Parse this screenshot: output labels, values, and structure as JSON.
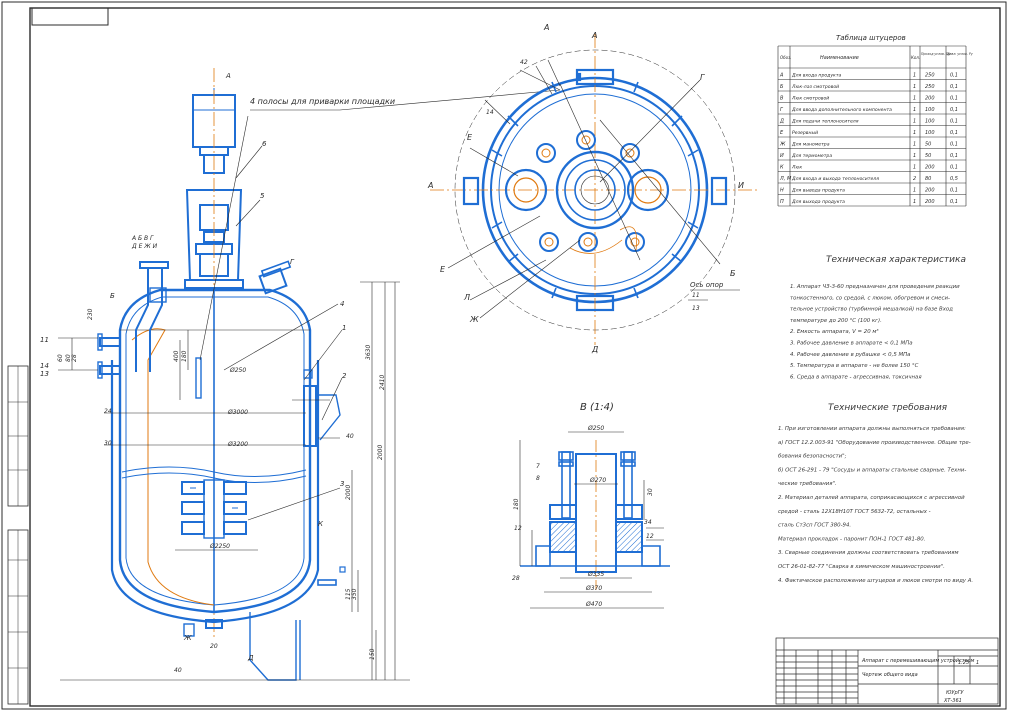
{
  "colors": {
    "outline": "#1f6ed4",
    "thin": "#2b2b2b",
    "axis": "#e07a10",
    "hatch": "#1f6ed4",
    "paper": "#ffffff"
  },
  "drawing": {
    "view_label_a": "А",
    "top_view_label_a": "А",
    "section_label_b": "Б",
    "section_label_v": "В",
    "section_label_g": "Г",
    "section_label_d": "Д",
    "section_label_e": "Е",
    "section_label_zh": "Ж",
    "section_label_i": "И",
    "section_label_k": "К",
    "section_label_l": "Л",
    "letters_row1": "А Б В Г",
    "letters_row2": "Д Е Ж И",
    "note_strips": "4 полосы для приварки площадки",
    "axis_of_support": "Ось опор",
    "angle_42": "42",
    "detail_title": "В (1:4)",
    "dims": {
      "d3000": "Ø3000",
      "d3200": "Ø3200",
      "d2250": "Ø2250",
      "d250": "Ø250",
      "d250b": "Ø250",
      "d270": "Ø270",
      "d335": "Ø335",
      "d370": "Ø370",
      "d470": "Ø470",
      "h3630": "3630",
      "h2410": "2410",
      "h2000": "2000",
      "h400": "400",
      "h180": "180",
      "h350": "350",
      "h115": "115",
      "h150": "150",
      "h230": "230",
      "h28": "28",
      "h40": "40",
      "h80": "80",
      "h20": "20",
      "h400b": "400",
      "h1": "1",
      "h2": "2",
      "h3": "3",
      "h4": "4",
      "h5": "5",
      "h6": "6",
      "h7": "7",
      "h8": "8",
      "h11": "11",
      "h14": "14",
      "h24": "24",
      "h30": "30",
      "h34": "34",
      "h40b": "40",
      "h60": "60",
      "h12": "12",
      "h13": "13"
    }
  },
  "nozzle_table": {
    "title": "Таблица штуцеров",
    "headers": [
      "Обоз.",
      "Наименование",
      "Кол.",
      "Проход услов. Dу",
      "Давл. услов. Pу"
    ],
    "rows": [
      [
        "А",
        "Для входа продукта",
        "1",
        "250",
        "0,1"
      ],
      [
        "Б",
        "Люк-лаз смотровой",
        "1",
        "250",
        "0,1"
      ],
      [
        "В",
        "Люк смотровой",
        "1",
        "200",
        "0,1"
      ],
      [
        "Г",
        "Для ввода дополнительного компонента",
        "1",
        "100",
        "0,1"
      ],
      [
        "Д",
        "Для подачи теплоносителя",
        "1",
        "100",
        "0,1"
      ],
      [
        "Е",
        "Резервный",
        "1",
        "100",
        "0,1"
      ],
      [
        "Ж",
        "Для манометра",
        "1",
        "50",
        "0,1"
      ],
      [
        "И",
        "Для термометра",
        "1",
        "50",
        "0,1"
      ],
      [
        "К",
        "Люк",
        "1",
        "200",
        "0,1"
      ],
      [
        "Л, М",
        "Для входа и выхода теплоносителя",
        "2",
        "80",
        "0,5"
      ],
      [
        "Н",
        "Для вывода продукта",
        "1",
        "200",
        "0,1"
      ],
      [
        "П",
        "Для выхода продукта",
        "1",
        "200",
        "0,1"
      ]
    ]
  },
  "tech_spec": {
    "title": "Техническая характеристика",
    "lines": [
      "1. Аппарат ЧЗ-3-60 предназначен для проведения реакции",
      "   тонкостенного, со средой, с люком, обогревом и смеси-",
      "   тельное устройство (турбинной мешалкой) на базе Вход",
      "   температуре до 200 °С (100 кг).",
      "2. Емкость аппарата, V = 20 м³",
      "3. Рабочее давление в аппарате  < 0,1 МПа",
      "4. Рабочее давление в рубашке  < 0,5 МПа",
      "5. Температура в аппарате - не более 150 °С",
      "6. Среда в аппарате - агрессивная, токсичная"
    ]
  },
  "tech_req": {
    "title": "Технические требования",
    "lines": [
      "1. При изготовлении аппарата должны выполняться требования:",
      "   а) ГОСТ 12.2.003-91 \"Оборудование производственное. Общие тре-",
      "      бования безопасности\";",
      "   б) ОСТ 26-291 - 79 \"Сосуды и аппараты стальные сварные. Техни-",
      "      ческие требования\".",
      "2. Материал деталей аппарата, соприкасающихся с агрессивной",
      "   средой - сталь 12Х18Н10Т ГОСТ 5632-72, остальных -",
      "   сталь Ст3сп ГОСТ 380-94.",
      "   Материал прокладок - паронит ПОН-1 ГОСТ 481-80.",
      "3. Сварные соединения должны соответствовать требованиям",
      "   ОСТ 26-01-82-77 \"Сварка в химическом машиностроении\".",
      "4. Фактическое расположение штуцеров и люков смотри по виду А."
    ]
  },
  "title_block": {
    "designation": "ЮУрГУ",
    "document_title": "Аппарат с перемешивающим устройством",
    "doc_sub": "Чертеж общего вида",
    "scale": "1:25",
    "sheet": "1",
    "org": "ЮУрГУ",
    "group": "ХТ-361"
  }
}
